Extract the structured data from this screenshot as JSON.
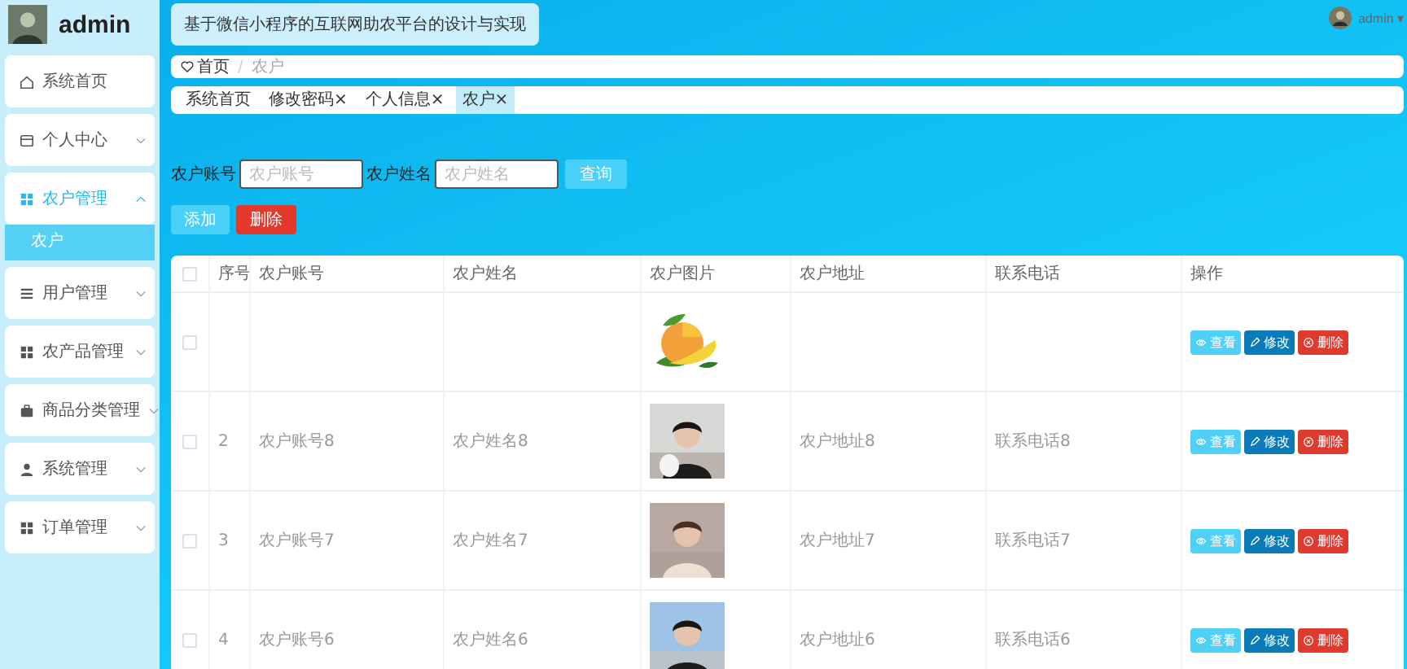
{
  "sidebar": {
    "user": "admin",
    "items": [
      {
        "label": "系统首页"
      },
      {
        "label": "个人中心",
        "expanded": false
      },
      {
        "label": "农户管理",
        "expanded": true,
        "children": [
          {
            "label": "农户",
            "selected": true
          }
        ]
      },
      {
        "label": "用户管理",
        "expanded": false
      },
      {
        "label": "农产品管理",
        "expanded": false
      },
      {
        "label": "商品分类管理",
        "expanded": false
      },
      {
        "label": "系统管理",
        "expanded": false
      },
      {
        "label": "订单管理",
        "expanded": false
      }
    ]
  },
  "header": {
    "title": "基于微信小程序的互联网助农平台的设计与实现",
    "user": "admin",
    "caret": "▾"
  },
  "breadcrumb": {
    "items": [
      "首页",
      "农户"
    ],
    "separator": "/"
  },
  "tags": [
    {
      "label": "系统首页",
      "selected": false
    },
    {
      "label": "修改密码",
      "close": "×",
      "selected": false
    },
    {
      "label": "个人信息",
      "close": "×",
      "selected": false
    },
    {
      "label": "农户",
      "close": "×",
      "selected": true
    }
  ],
  "search": {
    "fields": [
      {
        "label": "农户账号",
        "placeholder": "农户账号"
      },
      {
        "label": "农户姓名",
        "placeholder": "农户姓名"
      }
    ],
    "button": "查询"
  },
  "actions": {
    "add": "添加",
    "delete": "删除"
  },
  "table": {
    "header_checked": false,
    "columns": [
      "序号",
      "农户账号",
      "农户姓名",
      "农户图片",
      "农户地址",
      "联系电话",
      "操作"
    ],
    "rows": [
      {
        "checked": false,
        "buttons": [
          "查看",
          "修改",
          "删除"
        ]
      },
      {
        "checked": false,
        "no": "2",
        "account": "农户账号8",
        "name": "农户姓名8",
        "address": "农户地址8",
        "phone": "联系电话8",
        "buttons": [
          "查看",
          "修改",
          "删除"
        ]
      },
      {
        "checked": false,
        "no": "3",
        "account": "农户账号7",
        "name": "农户姓名7",
        "address": "农户地址7",
        "phone": "联系电话7",
        "buttons": [
          "查看",
          "修改",
          "删除"
        ]
      },
      {
        "checked": false,
        "no": "4",
        "account": "农户账号6",
        "name": "农户姓名6",
        "address": "农户地址6",
        "phone": "联系电话6",
        "buttons": [
          "查看",
          "修改",
          "删除"
        ]
      }
    ]
  }
}
